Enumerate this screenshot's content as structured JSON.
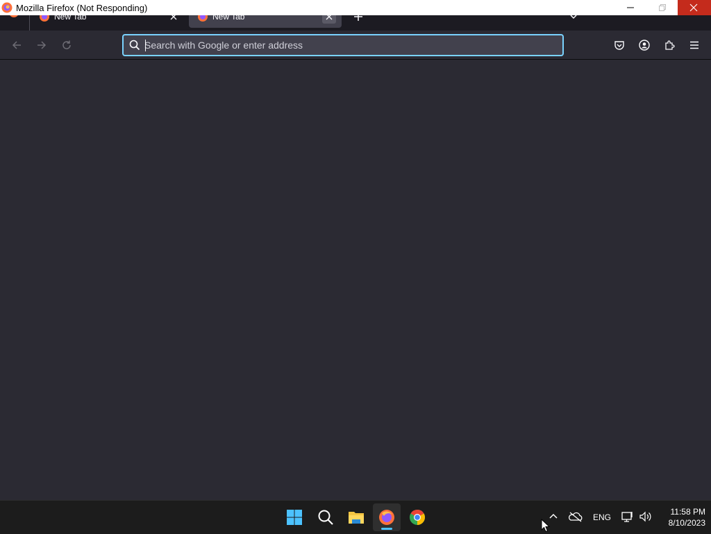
{
  "window": {
    "title": "Mozilla Firefox (Not Responding)",
    "controls": {
      "minimize": "minimize",
      "maximize": "maximize",
      "close": "close"
    }
  },
  "tabs": [
    {
      "label": "New Tab",
      "active": false
    },
    {
      "label": "New Tab",
      "active": true
    }
  ],
  "navbar": {
    "back": "back-arrow-icon",
    "forward": "forward-arrow-icon",
    "reload": "reload-icon",
    "urlbar": {
      "placeholder": "Search with Google or enter address",
      "value": ""
    },
    "toolbar_icons": [
      "pocket-icon",
      "account-icon",
      "extensions-icon",
      "menu-icon"
    ]
  },
  "taskbar": {
    "apps": [
      "start-icon",
      "search-icon",
      "file-explorer-icon",
      "firefox-icon",
      "chrome-icon"
    ],
    "active_app": "firefox",
    "tray": {
      "language": "ENG",
      "time": "11:58 PM",
      "date": "8/10/2023"
    }
  },
  "colors": {
    "accent": "#7ad3ff",
    "close_red": "#c42b1c",
    "page_bg": "#2b2a33",
    "taskbar_bg": "#1c1c1c"
  }
}
